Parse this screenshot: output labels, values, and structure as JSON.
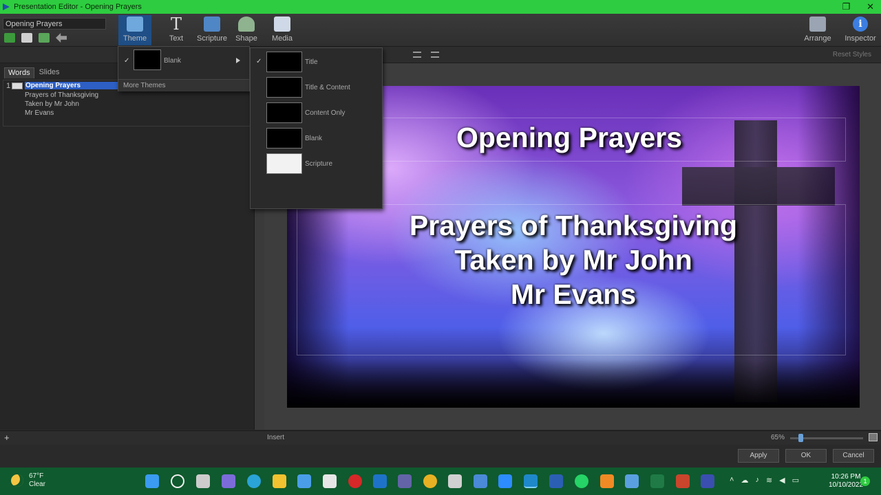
{
  "window": {
    "title": "Presentation Editor - Opening Prayers"
  },
  "toolbar": {
    "doc_title": "Opening Prayers",
    "tools": [
      {
        "label": "Theme"
      },
      {
        "label": "Text"
      },
      {
        "label": "Scripture"
      },
      {
        "label": "Shape"
      },
      {
        "label": "Media"
      }
    ],
    "right_tools": [
      {
        "label": "Arrange"
      },
      {
        "label": "Inspector"
      }
    ],
    "reset_styles": "Reset Styles"
  },
  "left_panel": {
    "tabs": [
      "Words",
      "Slides"
    ],
    "slides": [
      {
        "number": "1",
        "lines": [
          "Opening Prayers",
          "Prayers of Thanksgiving",
          "Taken by Mr John",
          "Mr Evans"
        ]
      }
    ]
  },
  "theme_menu": {
    "current": "Blank",
    "more": "More Themes"
  },
  "layout_menu": {
    "items": [
      "Title",
      "Title & Content",
      "Content Only",
      "Blank",
      "Scripture"
    ],
    "checked": "Title"
  },
  "slide": {
    "title": "Opening Prayers",
    "body": [
      "Prayers of Thanksgiving",
      "Taken by Mr John",
      "Mr Evans"
    ]
  },
  "statusbar": {
    "insert": "Insert",
    "zoom": "65%",
    "zoom_value_percent": 65
  },
  "footer": {
    "apply": "Apply",
    "ok": "OK",
    "cancel": "Cancel"
  },
  "taskbar": {
    "weather_temp": "67°F",
    "weather_desc": "Clear",
    "time": "10:26 PM",
    "date": "10/10/2022",
    "notifications": "1"
  },
  "colors": {
    "accent": "#2ecc40",
    "selection": "#2d5fc4",
    "taskbar": "#0f5a2e"
  }
}
